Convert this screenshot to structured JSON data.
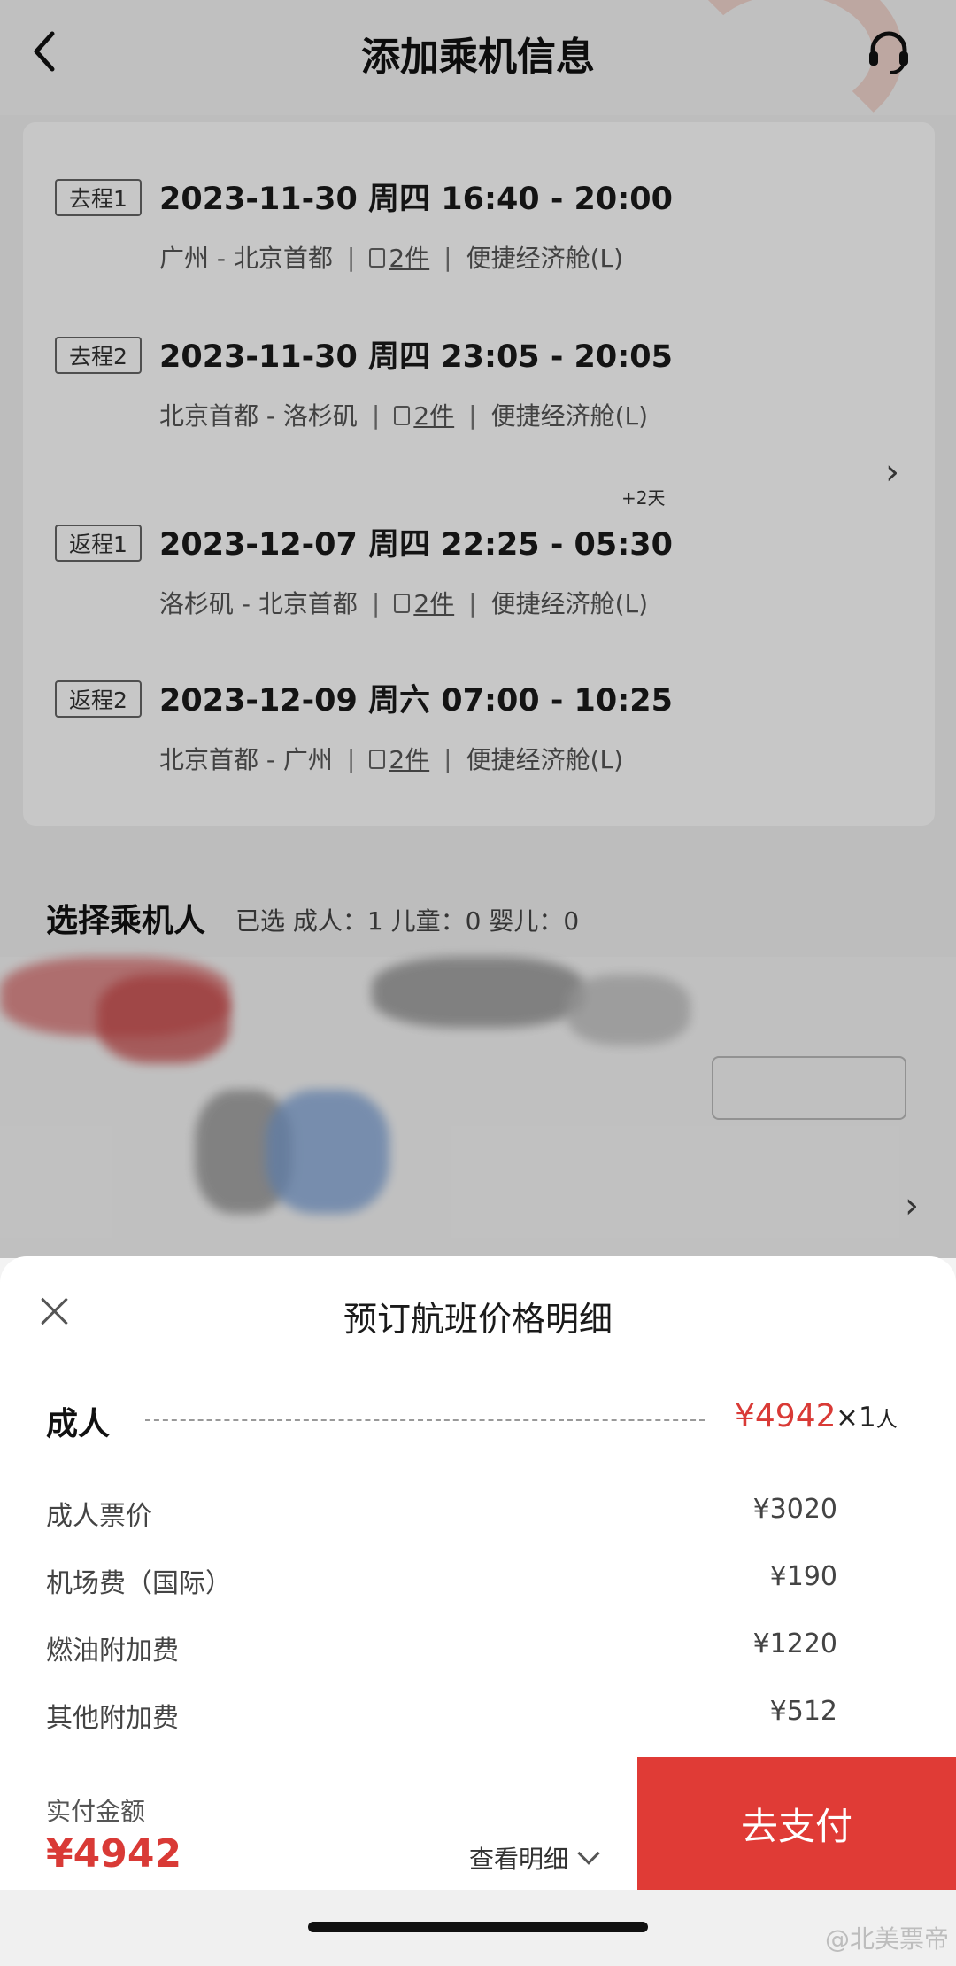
{
  "header": {
    "title": "添加乘机信息"
  },
  "segments": [
    {
      "tag": "去程1",
      "time": "2023-11-30 周四 16:40 - 20:00",
      "plus": "",
      "route": "广州 - 北京首都",
      "baggage": "2件",
      "cabin": "便捷经济舱(L)"
    },
    {
      "tag": "去程2",
      "time": "2023-11-30 周四 23:05 - 20:05",
      "plus": "",
      "route": "北京首都 - 洛杉矶",
      "baggage": "2件",
      "cabin": "便捷经济舱(L)"
    },
    {
      "tag": "返程1",
      "time": "2023-12-07 周四 22:25 - 05:30",
      "plus": "+2天",
      "route": "洛杉矶 - 北京首都",
      "baggage": "2件",
      "cabin": "便捷经济舱(L)"
    },
    {
      "tag": "返程2",
      "time": "2023-12-09 周六 07:00 - 10:25",
      "plus": "",
      "route": "北京首都 - 广州",
      "baggage": "2件",
      "cabin": "便捷经济舱(L)"
    }
  ],
  "passengers": {
    "title": "选择乘机人",
    "summary": "已选 成人：1  儿童：0  婴儿：0"
  },
  "sheet": {
    "title": "预订航班价格明细",
    "adult": {
      "label": "成人",
      "price": "¥4942",
      "multiplier": "×1",
      "unit": "人"
    },
    "fees": [
      {
        "label": "成人票价",
        "value": "¥3020"
      },
      {
        "label": "机场费（国际）",
        "value": "¥190"
      },
      {
        "label": "燃油附加费",
        "value": "¥1220"
      },
      {
        "label": "其他附加费",
        "value": "¥512"
      }
    ]
  },
  "pay_bar": {
    "paid_label": "实付金额",
    "paid_amount": "¥4942",
    "detail_link": "查看明细",
    "pay_button": "去支付"
  },
  "watermark": "@北美票帝",
  "colors": {
    "accent": "#e03b36",
    "price": "#d93a36"
  }
}
